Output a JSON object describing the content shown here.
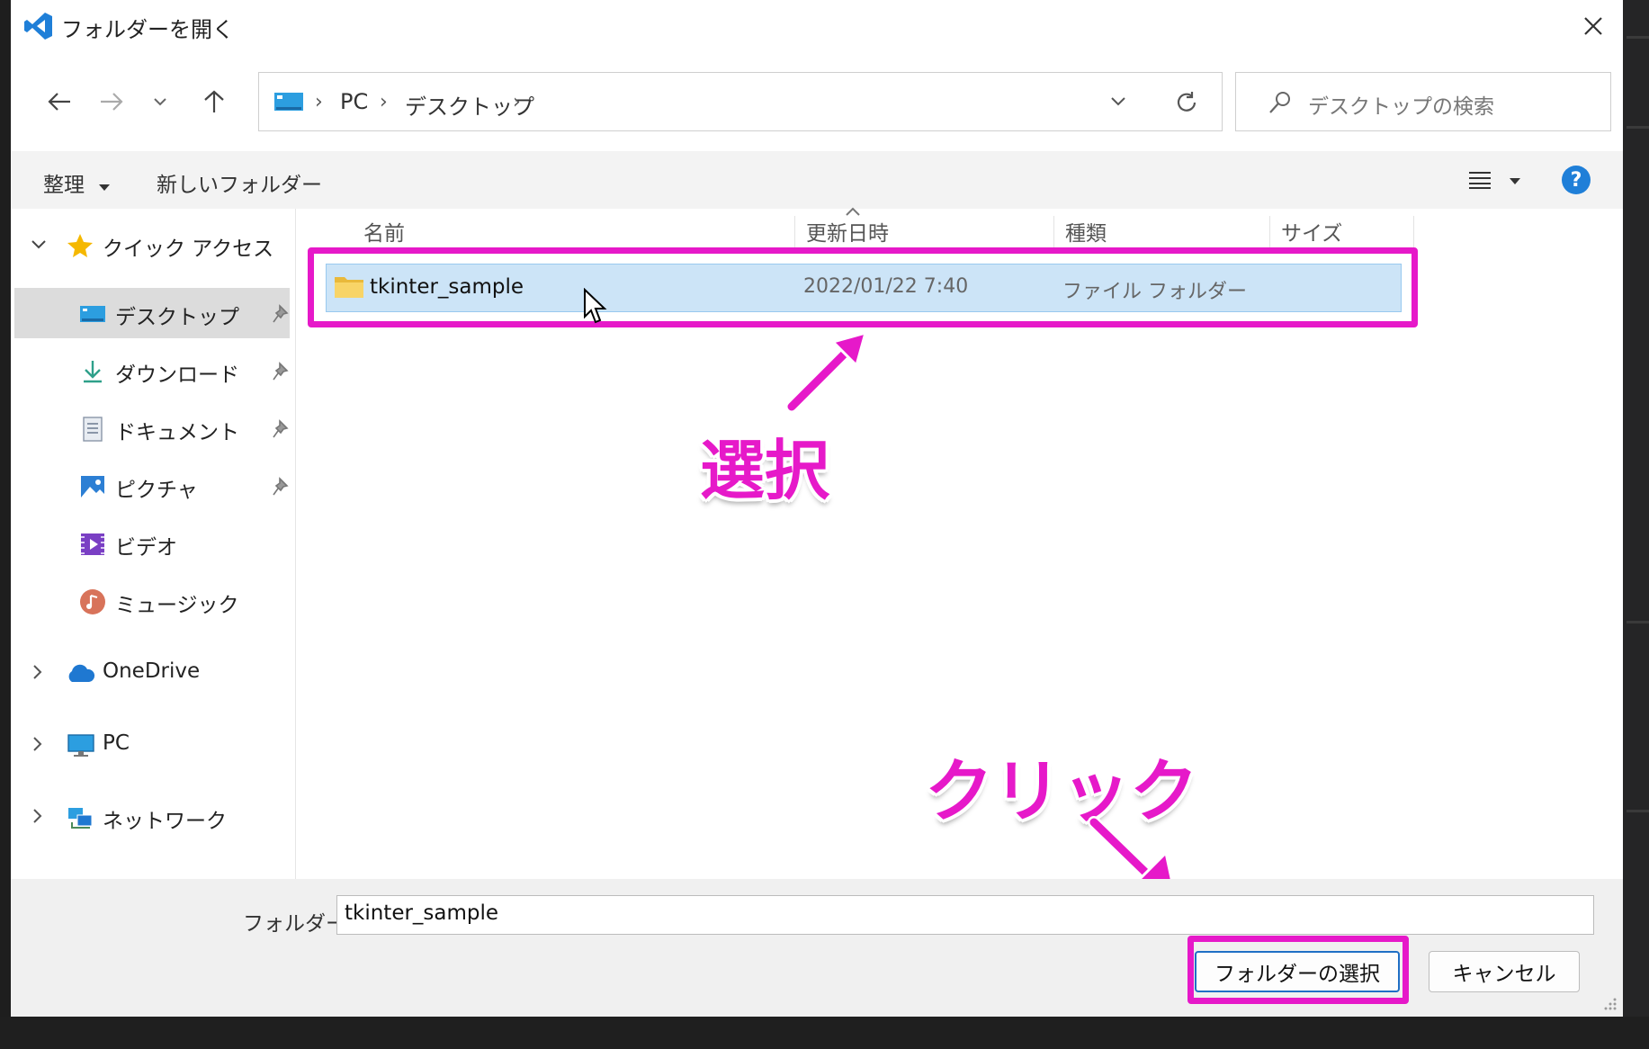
{
  "window": {
    "title": "フォルダーを開く",
    "accent_color": "#1f7fd8"
  },
  "address_bar": {
    "path": [
      "PC",
      "デスクトップ"
    ],
    "search_placeholder": "デスクトップの検索"
  },
  "toolbar": {
    "organize_label": "整理",
    "new_folder_label": "新しいフォルダー",
    "help_label": "?"
  },
  "sidebar": {
    "quick_access_label": "クイック アクセス",
    "items": [
      {
        "label": "デスクトップ",
        "icon": "desktop-icon",
        "pinned": true,
        "selected": true
      },
      {
        "label": "ダウンロード",
        "icon": "download-icon",
        "pinned": true
      },
      {
        "label": "ドキュメント",
        "icon": "document-icon",
        "pinned": true
      },
      {
        "label": "ピクチャ",
        "icon": "picture-icon",
        "pinned": true
      },
      {
        "label": "ビデオ",
        "icon": "video-icon",
        "pinned": false
      },
      {
        "label": "ミュージック",
        "icon": "music-icon",
        "pinned": false
      }
    ],
    "roots": [
      {
        "label": "OneDrive",
        "icon": "cloud-icon"
      },
      {
        "label": "PC",
        "icon": "computer-icon"
      },
      {
        "label": "ネットワーク",
        "icon": "network-icon"
      }
    ]
  },
  "file_list": {
    "columns": [
      "名前",
      "更新日時",
      "種類",
      "サイズ"
    ],
    "rows": [
      {
        "name": "tkinter_sample",
        "modified": "2022/01/22 7:40",
        "type": "ファイル フォルダー",
        "size": ""
      }
    ]
  },
  "footer": {
    "folder_label": "フォルダー:",
    "folder_value": "tkinter_sample",
    "select_button": "フォルダーの選択",
    "cancel_button": "キャンセル"
  },
  "annotations": {
    "select_text": "選択",
    "click_text": "クリック",
    "highlight_color": "#e619c9"
  }
}
